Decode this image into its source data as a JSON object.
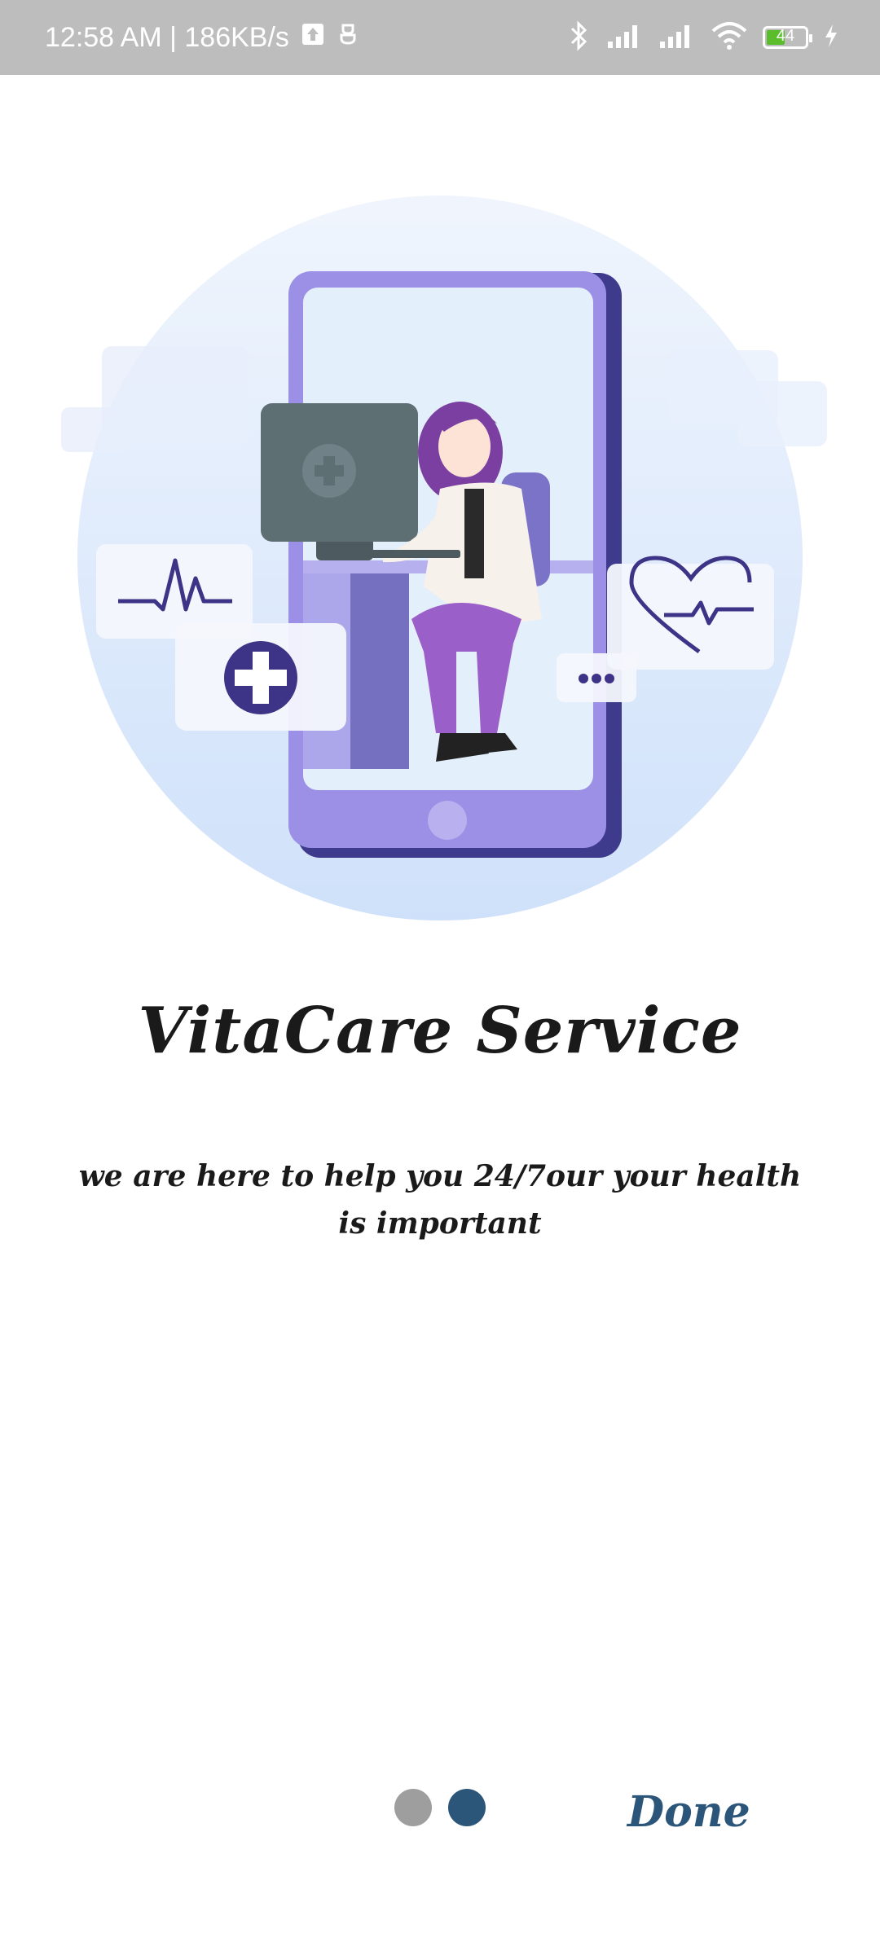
{
  "status_bar": {
    "time_speed": "12:58 AM | 186KB/s",
    "battery_level": "44"
  },
  "onboarding": {
    "title": "VitaCare Service",
    "description": "we are here to help you 24/7our your health is important",
    "pager": {
      "total": 2,
      "current": 2
    },
    "done_label": "Done"
  },
  "colors": {
    "accent": "#2b567a",
    "dot_inactive": "#9e9e9e",
    "illustration_purple": "#9b8fe6"
  }
}
